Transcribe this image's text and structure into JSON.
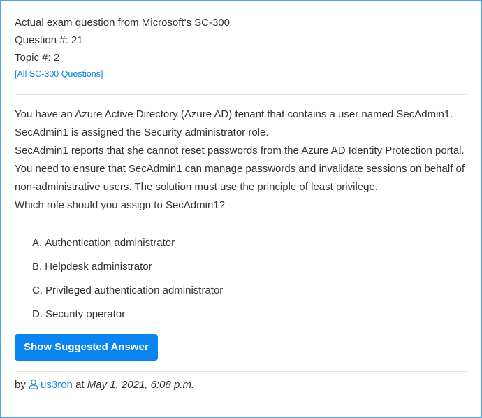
{
  "header": {
    "exam_line": "Actual exam question from Microsoft's SC-300",
    "question_number": "Question #: 21",
    "topic": "Topic #: 2",
    "all_questions_link": "[All SC-300 Questions]"
  },
  "question": {
    "paragraphs": [
      "You have an Azure Active Directory (Azure AD) tenant that contains a user named SecAdmin1.",
      "SecAdmin1 is assigned the Security administrator role.",
      "SecAdmin1 reports that she cannot reset passwords from the Azure AD Identity Protection portal.",
      "You need to ensure that SecAdmin1 can manage passwords and invalidate sessions on behalf of non-administrative users. The solution must use the principle of least privilege.",
      "Which role should you assign to SecAdmin1?"
    ]
  },
  "choices": [
    {
      "letter": "A.",
      "text": "Authentication administrator"
    },
    {
      "letter": "B.",
      "text": "Helpdesk administrator"
    },
    {
      "letter": "C.",
      "text": "Privileged authentication administrator"
    },
    {
      "letter": "D.",
      "text": "Security operator"
    }
  ],
  "answer_button": {
    "label": "Show Suggested Answer"
  },
  "footer": {
    "by": "by",
    "user_icon": "user-icon",
    "username": "us3ron",
    "at": "at",
    "date": "May 1, 2021, 6:08 p.m."
  },
  "colors": {
    "border": "#4aa3df",
    "link": "#0a86d8",
    "button": "#0a85ef",
    "text": "#333333"
  }
}
